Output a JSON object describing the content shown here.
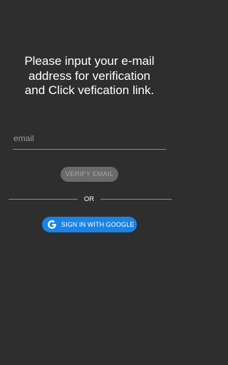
{
  "heading": {
    "line1": "Please input your e-mail",
    "line2": "address for verification",
    "line3": "and Click vefication link."
  },
  "email": {
    "placeholder": "email",
    "value": ""
  },
  "verify_button": {
    "label": "VERIFY EMAIL",
    "enabled": false
  },
  "divider": {
    "label": "OR"
  },
  "google_button": {
    "label": "SIGN IN WITH GOOGLE",
    "icon": "google-g-icon"
  },
  "colors": {
    "background": "#2e2e2e",
    "google_blue": "#1a83e6",
    "disabled_button": "#6a6a6a"
  }
}
